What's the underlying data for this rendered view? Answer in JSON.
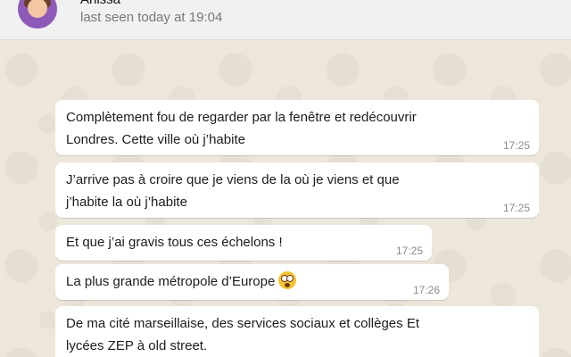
{
  "header": {
    "contact_name": "Anissa",
    "last_seen": "last seen today at 19:04"
  },
  "messages": [
    {
      "text": "Complètement fou de regarder par la fenêtre et redécouvrir\nLondres. Cette ville où j’habite",
      "time": "17:25"
    },
    {
      "text": "J’arrive pas à croire que je viens de la où je viens et que\nj’habite la où j’habite",
      "time": "17:25"
    },
    {
      "text": "Et que j’ai gravis tous ces échelons !",
      "time": "17:25"
    },
    {
      "text": "La plus grande métropole d’Europe",
      "emoji": "flushed-face",
      "time": "17:26"
    },
    {
      "text": "De ma cité marseillaise, des services sociaux et collèges Et\nlycées ZEP à old street.",
      "time": ""
    }
  ]
}
